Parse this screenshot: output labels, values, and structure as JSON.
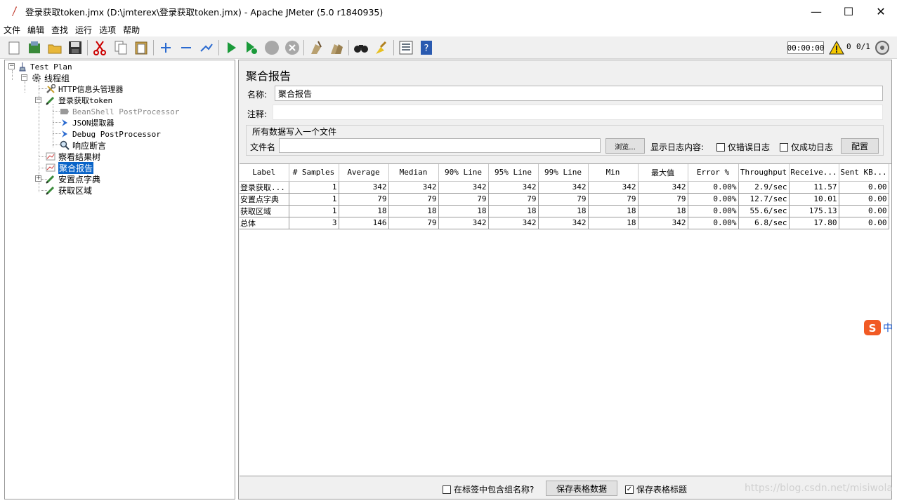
{
  "window": {
    "title": "登录获取token.jmx (D:\\jmterex\\登录获取token.jmx) - Apache JMeter (5.0 r1840935)",
    "minimize": "—",
    "maximize": "☐",
    "close": "✕"
  },
  "menu": [
    "文件",
    "编辑",
    "查找",
    "运行",
    "选项",
    "帮助"
  ],
  "toolbar": {
    "timer": "00:00:00",
    "warn_count": "0",
    "threads": "0/1"
  },
  "tree": {
    "test_plan": "Test Plan",
    "thread_group": "线程组",
    "http_header": "HTTP信息头管理器",
    "login": "登录获取token",
    "beanshell": "BeanShell PostProcessor",
    "json_extractor": "JSON提取器",
    "debug": "Debug PostProcessor",
    "assertion": "响应断言",
    "results_tree": "察看结果树",
    "aggregate": "聚合报告",
    "dict": "安置点字典",
    "region": "获取区域"
  },
  "panel": {
    "title": "聚合报告",
    "name_label": "名称:",
    "name_value": "聚合报告",
    "comment_label": "注释:",
    "comment_value": "",
    "file_section": "所有数据写入一个文件",
    "filename_label": "文件名",
    "filename_value": "",
    "browse": "浏览...",
    "log_label": "显示日志内容:",
    "errors_only": "仅错误日志",
    "success_only": "仅成功日志",
    "configure": "配置"
  },
  "table": {
    "headers": [
      "Label",
      "# Samples",
      "Average",
      "Median",
      "90% Line",
      "95% Line",
      "99% Line",
      "Min",
      "最大值",
      "Error %",
      "Throughput",
      "Receive...",
      "Sent KB..."
    ],
    "rows": [
      [
        "登录获取...",
        "1",
        "342",
        "342",
        "342",
        "342",
        "342",
        "342",
        "342",
        "0.00%",
        "2.9/sec",
        "11.57",
        "0.00"
      ],
      [
        "安置点字典",
        "1",
        "79",
        "79",
        "79",
        "79",
        "79",
        "79",
        "79",
        "0.00%",
        "12.7/sec",
        "10.01",
        "0.00"
      ],
      [
        "获取区域",
        "1",
        "18",
        "18",
        "18",
        "18",
        "18",
        "18",
        "18",
        "0.00%",
        "55.6/sec",
        "175.13",
        "0.00"
      ],
      [
        "总体",
        "3",
        "146",
        "79",
        "342",
        "342",
        "342",
        "18",
        "342",
        "0.00%",
        "6.8/sec",
        "17.80",
        "0.00"
      ]
    ]
  },
  "footer": {
    "include_group": "在标签中包含组名称?",
    "save_table": "保存表格数据",
    "save_header": "保存表格标题"
  },
  "watermark": "https://blog.csdn.net/misiwola",
  "ime": "中"
}
